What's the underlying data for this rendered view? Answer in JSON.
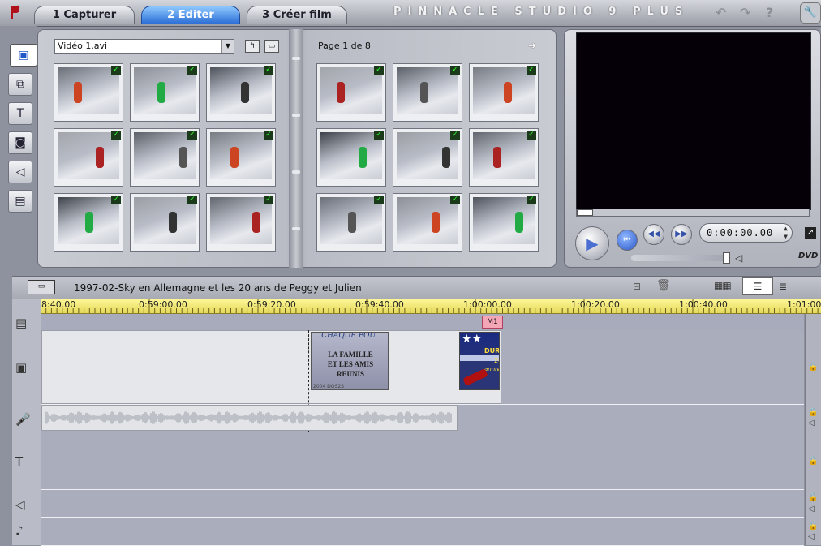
{
  "app": {
    "tabs": [
      {
        "label": "1 Capturer"
      },
      {
        "label": "2 Editer"
      },
      {
        "label": "3 Créer film"
      }
    ],
    "brand": "PINNACLE STUDIO 9 PLUS",
    "icons": [
      "undo-icon",
      "redo-icon",
      "help-icon",
      "settings-wrench-icon"
    ]
  },
  "left_toolbar": [
    "video-clips-icon",
    "transitions-icon",
    "titles-icon",
    "photos-icon",
    "sound-effects-icon",
    "menus-icon"
  ],
  "album": {
    "source_file": "Vidéo 1.avi",
    "page_label": "Page 1 de 8",
    "left_page_thumbs": 9,
    "right_page_thumbs": 9
  },
  "player": {
    "timecode": "0:00:00.00",
    "logo": "DVD"
  },
  "timeline": {
    "project_title": "1997-02-Sky en Allemagne et les 20 ans de Peggy et Julien",
    "ticks": [
      "8:40.00",
      "0:59:00.00",
      "0:59:20.00",
      "0:59:40.00",
      "1:00:00.00",
      "1:00:20.00",
      "1:00:40.00",
      "1:01:00"
    ],
    "marker": "M1",
    "title_clip_text": [
      "LA FAMILLE",
      "ET LES AMIS",
      "REUNIS"
    ],
    "title_clip_header": "'. CHAQUE FOU",
    "title_clip_footer": "2004   DOS2S",
    "flag_clip_text": [
      "DUR",
      "20",
      "anniv"
    ]
  },
  "colors": {
    "active_tab": "#2d6fd6",
    "ruler": "#fff89a",
    "player_screen": "#050008"
  }
}
